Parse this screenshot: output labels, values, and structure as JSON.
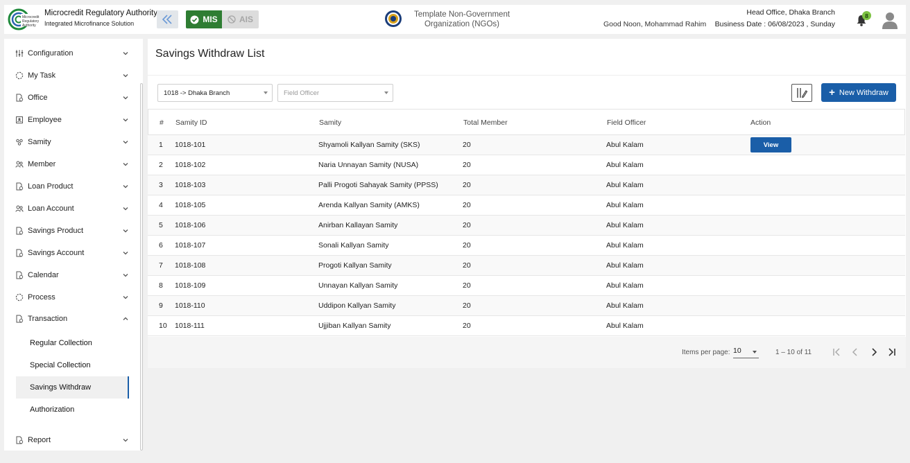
{
  "header": {
    "logo_text": "Microcredit Regulatory Authority",
    "brand_title": "Microcredit Regulatory Authority",
    "brand_subtitle": "Integrated Microfinance Solution",
    "mis_label": "MIS",
    "ais_label": "AIS",
    "org_name": "Template Non-Government Organization (NGOs)",
    "greeting": "Good Noon, Mohammad Rahim",
    "branch": "Head Office, Dhaka Branch",
    "business_date": "Business Date : 06/08/2023 , Sunday",
    "notification_count": "8"
  },
  "sidebar": {
    "items": [
      {
        "label": "Configuration",
        "icon": "sliders-icon"
      },
      {
        "label": "My Task",
        "icon": "dashed-circle-icon"
      },
      {
        "label": "Office",
        "icon": "document-icon"
      },
      {
        "label": "Employee",
        "icon": "badge-icon"
      },
      {
        "label": "Samity",
        "icon": "group-icon"
      },
      {
        "label": "Member",
        "icon": "people-icon"
      },
      {
        "label": "Loan Product",
        "icon": "document-icon"
      },
      {
        "label": "Loan Account",
        "icon": "people-icon"
      },
      {
        "label": "Savings Product",
        "icon": "document-icon"
      },
      {
        "label": "Savings Account",
        "icon": "document-icon"
      },
      {
        "label": "Calendar",
        "icon": "document-icon"
      },
      {
        "label": "Process",
        "icon": "dashed-circle-icon"
      },
      {
        "label": "Transaction",
        "icon": "document-icon"
      },
      {
        "label": "Report",
        "icon": "document-icon"
      }
    ],
    "transaction_sub": [
      {
        "label": "Regular Collection"
      },
      {
        "label": "Special Collection"
      },
      {
        "label": "Savings Withdraw"
      },
      {
        "label": "Authorization"
      }
    ]
  },
  "main": {
    "title": "Savings Withdraw List",
    "branch_select": "1018 -> Dhaka Branch",
    "officer_placeholder": "Field Officer",
    "new_button": "New Withdraw",
    "columns": [
      "#",
      "Samity ID",
      "Samity",
      "Total Member",
      "Field Officer",
      "Action"
    ],
    "view_label": "View",
    "rows": [
      {
        "num": "1",
        "id": "1018-101",
        "samity": "Shyamoli Kallyan Samity (SKS)",
        "members": "20",
        "officer": "Abul Kalam"
      },
      {
        "num": "2",
        "id": "1018-102",
        "samity": "Naria Unnayan Samity (NUSA)",
        "members": "20",
        "officer": "Abul Kalam"
      },
      {
        "num": "3",
        "id": "1018-103",
        "samity": "Palli Progoti Sahayak Samity (PPSS)",
        "members": "20",
        "officer": "Abul Kalam"
      },
      {
        "num": "4",
        "id": "1018-105",
        "samity": "Arenda Kallyan Samity (AMKS)",
        "members": "20",
        "officer": "Abul Kalam"
      },
      {
        "num": "5",
        "id": "1018-106",
        "samity": "Anirban Kallayan Samity",
        "members": "20",
        "officer": "Abul Kalam"
      },
      {
        "num": "6",
        "id": "1018-107",
        "samity": "Sonali Kallyan Samity",
        "members": "20",
        "officer": "Abul Kalam"
      },
      {
        "num": "7",
        "id": "1018-108",
        "samity": "Progoti Kallyan Samity",
        "members": "20",
        "officer": "Abul Kalam"
      },
      {
        "num": "8",
        "id": "1018-109",
        "samity": "Unnayan Kallyan Samity",
        "members": "20",
        "officer": "Abul Kalam"
      },
      {
        "num": "9",
        "id": "1018-110",
        "samity": "Uddipon Kallyan Samity",
        "members": "20",
        "officer": "Abul Kalam"
      },
      {
        "num": "10",
        "id": "1018-111",
        "samity": "Ujjiban Kallyan Samity",
        "members": "20",
        "officer": "Abul Kalam"
      }
    ],
    "paginator": {
      "items_label": "Items per page:",
      "page_size": "10",
      "range": "1 – 10 of 11"
    }
  },
  "colors": {
    "primary": "#1a5ea8",
    "mis_green": "#2e7d32",
    "badge_green": "#7cc241"
  }
}
